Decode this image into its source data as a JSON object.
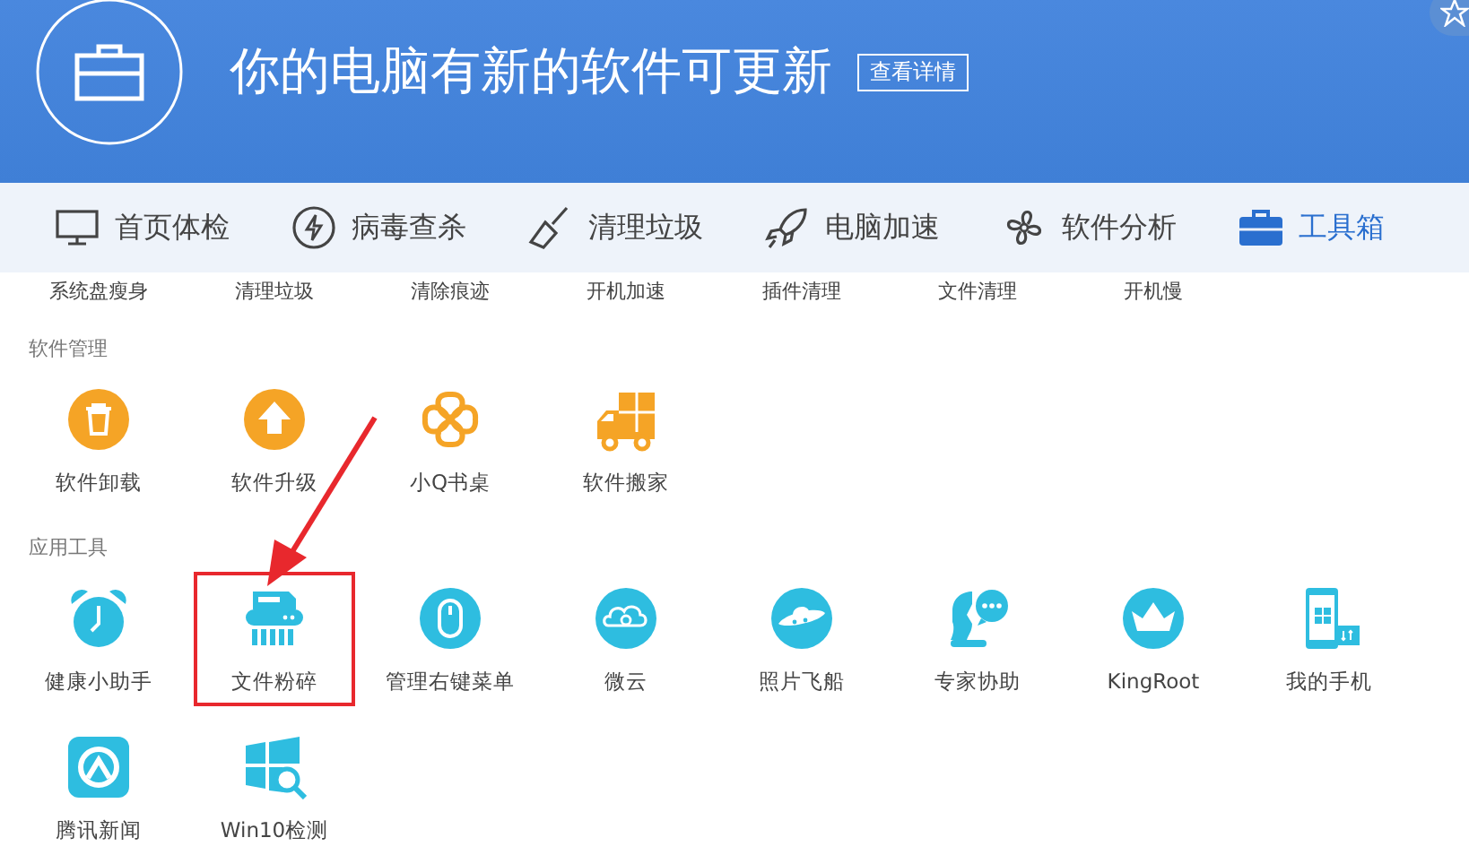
{
  "header": {
    "title": "你的电脑有新的软件可更新",
    "details_button": "查看详情"
  },
  "tabs": [
    {
      "label": "首页体检",
      "selected": false
    },
    {
      "label": "病毒查杀",
      "selected": false
    },
    {
      "label": "清理垃圾",
      "selected": false
    },
    {
      "label": "电脑加速",
      "selected": false
    },
    {
      "label": "软件分析",
      "selected": false
    },
    {
      "label": "工具箱",
      "selected": true
    }
  ],
  "previous_row": [
    "系统盘瘦身",
    "清理垃圾",
    "清除痕迹",
    "开机加速",
    "插件清理",
    "文件清理",
    "开机慢"
  ],
  "sections": [
    {
      "title": "软件管理",
      "color": "#f5a426",
      "items": [
        {
          "label": "软件卸载",
          "highlighted": false
        },
        {
          "label": "软件升级",
          "highlighted": false
        },
        {
          "label": "小Q书桌",
          "highlighted": false
        },
        {
          "label": "软件搬家",
          "highlighted": false
        }
      ]
    },
    {
      "title": "应用工具",
      "color": "#2ebde0",
      "items": [
        {
          "label": "健康小助手",
          "highlighted": false
        },
        {
          "label": "文件粉碎",
          "highlighted": true
        },
        {
          "label": "管理右键菜单",
          "highlighted": false
        },
        {
          "label": "微云",
          "highlighted": false
        },
        {
          "label": "照片飞船",
          "highlighted": false
        },
        {
          "label": "专家协助",
          "highlighted": false
        },
        {
          "label": "KingRoot",
          "highlighted": false
        },
        {
          "label": "我的手机",
          "highlighted": false
        },
        {
          "label": "腾讯新闻",
          "highlighted": false
        },
        {
          "label": "Win10检测",
          "highlighted": false
        }
      ]
    }
  ]
}
